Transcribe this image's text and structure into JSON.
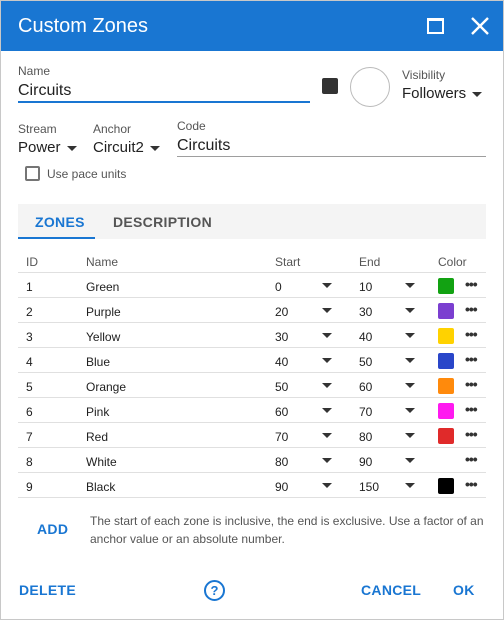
{
  "window": {
    "title": "Custom Zones"
  },
  "name_field": {
    "label": "Name",
    "value": "Circuits"
  },
  "visibility": {
    "label": "Visibility",
    "value": "Followers"
  },
  "stream": {
    "label": "Stream",
    "value": "Power"
  },
  "anchor": {
    "label": "Anchor",
    "value": "Circuit2"
  },
  "code": {
    "label": "Code",
    "value": "Circuits"
  },
  "pace_units": {
    "label": "Use pace units",
    "checked": false
  },
  "tabs": [
    {
      "label": "ZONES",
      "active": true
    },
    {
      "label": "DESCRIPTION",
      "active": false
    }
  ],
  "table": {
    "headers": {
      "id": "ID",
      "name": "Name",
      "start": "Start",
      "end": "End",
      "color": "Color"
    },
    "rows": [
      {
        "id": "1",
        "name": "Green",
        "start": "0",
        "end": "10",
        "color": "#12a212"
      },
      {
        "id": "2",
        "name": "Purple",
        "start": "20",
        "end": "30",
        "color": "#7b3fd0"
      },
      {
        "id": "3",
        "name": "Yellow",
        "start": "30",
        "end": "40",
        "color": "#ffd200"
      },
      {
        "id": "4",
        "name": "Blue",
        "start": "40",
        "end": "50",
        "color": "#2946c9"
      },
      {
        "id": "5",
        "name": "Orange",
        "start": "50",
        "end": "60",
        "color": "#ff8a0c"
      },
      {
        "id": "6",
        "name": "Pink",
        "start": "60",
        "end": "70",
        "color": "#ff19f0"
      },
      {
        "id": "7",
        "name": "Red",
        "start": "70",
        "end": "80",
        "color": "#e02a2a"
      },
      {
        "id": "8",
        "name": "White",
        "start": "80",
        "end": "90",
        "color": "#ffffff"
      },
      {
        "id": "9",
        "name": "Black",
        "start": "90",
        "end": "150",
        "color": "#000000"
      }
    ]
  },
  "add_label": "ADD",
  "hint": "The start of each zone is inclusive, the end is exclusive. Use a factor of an anchor value or an absolute number.",
  "footer": {
    "delete_label": "DELETE",
    "help_glyph": "?",
    "cancel_label": "CANCEL",
    "ok_label": "OK"
  },
  "colors": {
    "accent": "#1976d2"
  }
}
